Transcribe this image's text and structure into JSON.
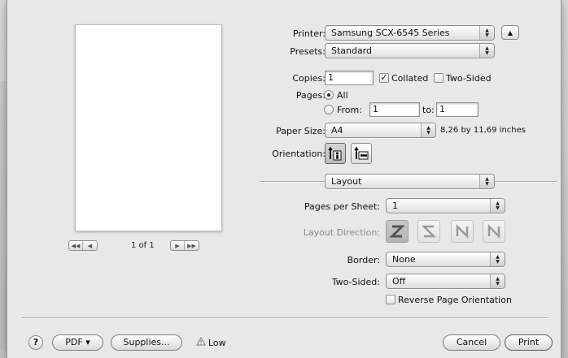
{
  "printer": {
    "label": "Printer:",
    "value": "Samsung SCX-6545 Series"
  },
  "presets": {
    "label": "Presets:",
    "value": "Standard"
  },
  "copies": {
    "label": "Copies:",
    "value": "1"
  },
  "collated": {
    "label": "Collated",
    "checked": true
  },
  "two_sided_check": {
    "label": "Two-Sided",
    "checked": false
  },
  "pages": {
    "label": "Pages:",
    "all_label": "All",
    "from_label": "From:",
    "from_value": "1",
    "to_label": "to:",
    "to_value": "1",
    "selected": "All"
  },
  "paper_size": {
    "label": "Paper Size:",
    "value": "A4",
    "dimensions": "8,26 by 11,69 inches"
  },
  "orientation": {
    "label": "Orientation:",
    "selected": "portrait"
  },
  "section_popup": "Layout",
  "pages_per_sheet": {
    "label": "Pages per Sheet:",
    "value": "1"
  },
  "layout_direction": {
    "label": "Layout Direction:"
  },
  "border": {
    "label": "Border:",
    "value": "None"
  },
  "two_sided": {
    "label": "Two-Sided:",
    "value": "Off"
  },
  "reverse_orientation": {
    "label": "Reverse Page Orientation",
    "checked": false
  },
  "preview": {
    "page_count": "1 of 1"
  },
  "footer": {
    "help": "?",
    "pdf": "PDF ▾",
    "supplies": "Supplies...",
    "supply_status": "Low",
    "cancel": "Cancel",
    "print": "Print"
  },
  "icons": {
    "disclosure": "triangle-up-icon",
    "warning": "warning-triangle-icon"
  }
}
